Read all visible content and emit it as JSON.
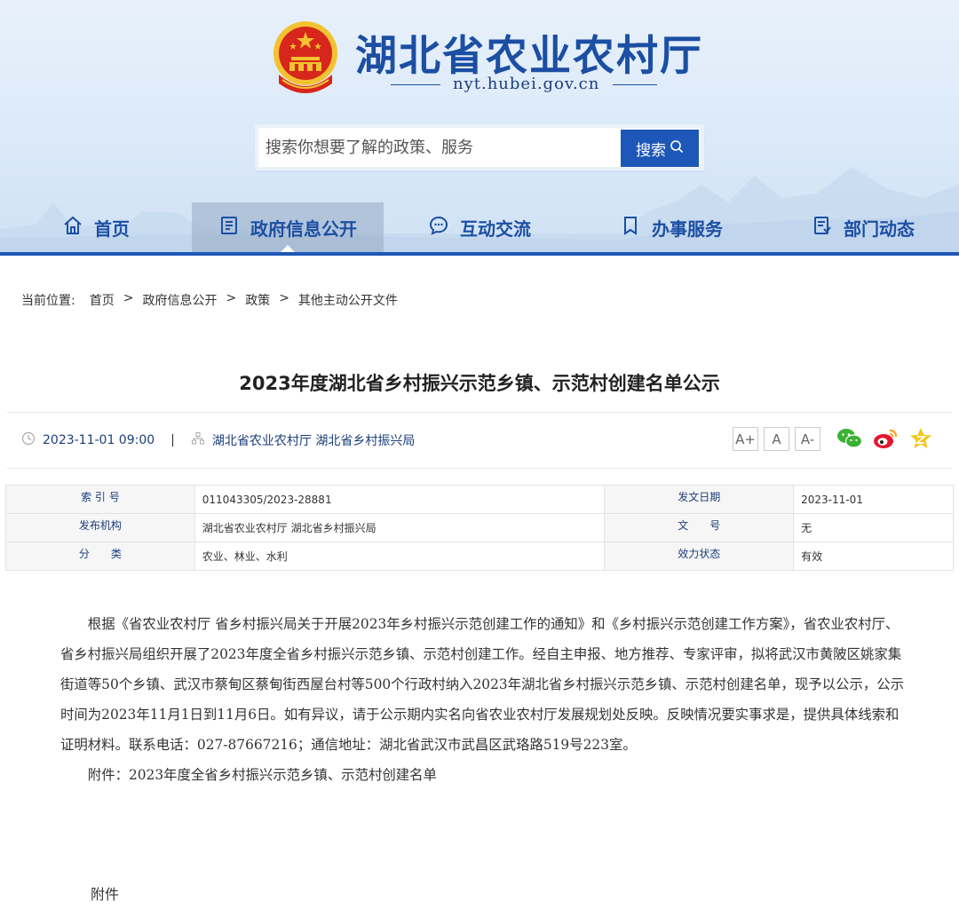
{
  "header": {
    "site_title": "湖北省农业农村厅",
    "site_domain": "nyt.hubei.gov.cn",
    "search_placeholder": "搜索你想要了解的政策、服务",
    "search_button": "搜索"
  },
  "nav": {
    "items": [
      {
        "label": "首页",
        "icon": "home-icon"
      },
      {
        "label": "政府信息公开",
        "icon": "document-icon"
      },
      {
        "label": "互动交流",
        "icon": "chat-icon"
      },
      {
        "label": "办事服务",
        "icon": "bookmark-icon"
      },
      {
        "label": "部门动态",
        "icon": "news-icon"
      }
    ],
    "active_index": 1
  },
  "breadcrumb": {
    "label": "当前位置:",
    "items": [
      "首页",
      "政府信息公开",
      "政策",
      "其他主动公开文件"
    ],
    "separator": ">"
  },
  "article": {
    "title": "2023年度湖北省乡村振兴示范乡镇、示范村创建名单公示",
    "datetime": "2023-11-01 09:00",
    "source": "湖北省农业农村厅 湖北省乡村振兴局",
    "font_sizes": [
      "A+",
      "A",
      "A-"
    ],
    "share": [
      "wechat-icon",
      "weibo-icon",
      "qzone-icon"
    ]
  },
  "info_table": {
    "rows": [
      {
        "k1": "索 引 号",
        "v1": "011043305/2023-28881",
        "k2": "发文日期",
        "v2": "2023-11-01"
      },
      {
        "k1": "发布机构",
        "v1": "湖北省农业农村厅 湖北省乡村振兴局",
        "k2": "文　　号",
        "v2": "无"
      },
      {
        "k1": "分　　类",
        "v1": "农业、林业、水利",
        "k2": "效力状态",
        "v2": "有效"
      }
    ]
  },
  "content": {
    "paragraph": "根据《省农业农村厅 省乡村振兴局关于开展2023年乡村振兴示范创建工作的通知》和《乡村振兴示范创建工作方案》，省农业农村厅、省乡村振兴局组织开展了2023年度全省乡村振兴示范乡镇、示范村创建工作。经自主申报、地方推荐、专家评审，拟将武汉市黄陂区姚家集街道等50个乡镇、武汉市蔡甸区蔡甸街西屋台村等500个行政村纳入2023年湖北省乡村振兴示范乡镇、示范村创建名单，现予以公示，公示时间为2023年11月1日到11月6日。如有异议，请于公示期内实名向省农业农村厅发展规划处反映。反映情况要实事求是，提供具体线索和证明材料。联系电话：027-87667216；通信地址：湖北省武汉市武昌区武珞路519号223室。",
    "attachment_line": "附件：2023年度全省乡村振兴示范乡镇、示范村创建名单",
    "attachment_label": "附件"
  },
  "colors": {
    "brand_blue": "#1d58b8",
    "title_blue": "#1c4fa3",
    "emblem_red": "#d7261b",
    "emblem_gold": "#f2c230"
  }
}
